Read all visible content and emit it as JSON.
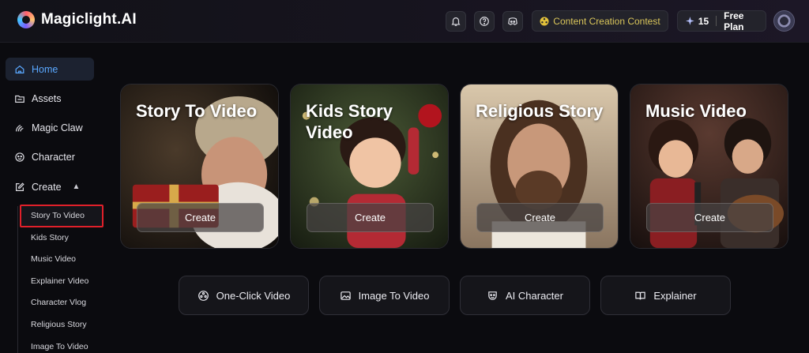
{
  "brand": {
    "name": "Magiclight.AI"
  },
  "header": {
    "contest_label": "Content Creation Contest",
    "credits": "15",
    "plan_label": "Free Plan",
    "icons": [
      "bell-icon",
      "help-icon",
      "discord-icon"
    ]
  },
  "sidebar": {
    "items": [
      {
        "label": "Home",
        "icon": "home-icon",
        "active": true
      },
      {
        "label": "Assets",
        "icon": "folder-icon"
      },
      {
        "label": "Magic Claw",
        "icon": "claw-icon"
      },
      {
        "label": "Character",
        "icon": "character-icon"
      },
      {
        "label": "Create",
        "icon": "create-icon",
        "expanded": true
      }
    ],
    "create_sub": [
      {
        "label": "Story To Video",
        "highlighted": true
      },
      {
        "label": "Kids Story"
      },
      {
        "label": "Music Video"
      },
      {
        "label": "Explainer Video"
      },
      {
        "label": "Character Vlog"
      },
      {
        "label": "Religious Story"
      },
      {
        "label": "Image To Video"
      }
    ]
  },
  "cards": [
    {
      "title": "Story To Video",
      "button": "Create"
    },
    {
      "title": "Kids Story Video",
      "button": "Create"
    },
    {
      "title": "Religious Story",
      "button": "Create"
    },
    {
      "title": "Music Video",
      "button": "Create"
    }
  ],
  "quick_actions": [
    {
      "label": "One-Click Video",
      "icon": "film-reel-icon"
    },
    {
      "label": "Image To Video",
      "icon": "image-icon"
    },
    {
      "label": "AI Character",
      "icon": "mask-icon"
    },
    {
      "label": "Explainer",
      "icon": "book-icon"
    }
  ],
  "colors": {
    "accent": "#5aa8ff",
    "highlight_border": "#e0202a",
    "contest_text": "#d9c55a",
    "background": "#0b0b0f"
  }
}
